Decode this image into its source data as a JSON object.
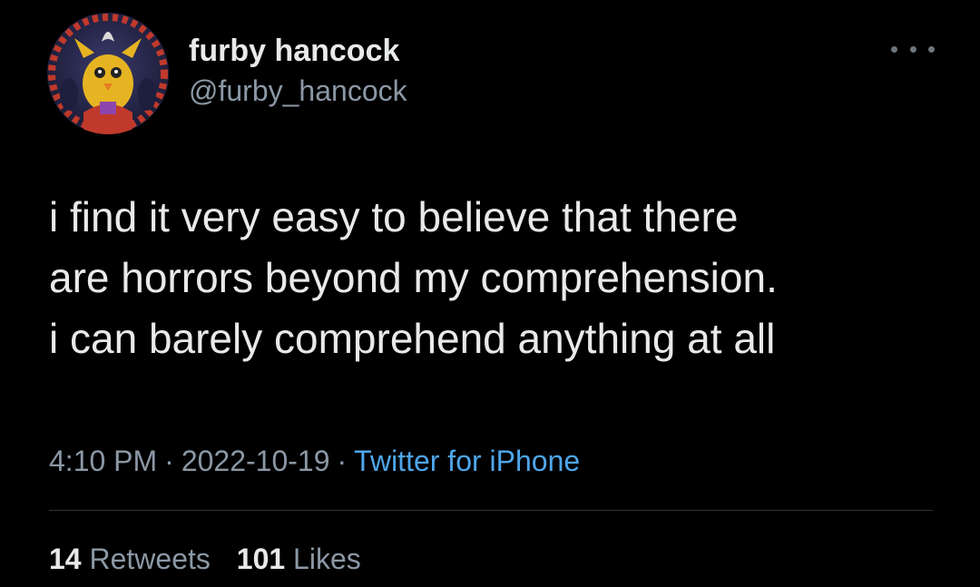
{
  "author": {
    "display_name": "furby hancock",
    "handle": "@furby_hancock",
    "avatar_icon": "furby-avatar-icon"
  },
  "tweet": {
    "lines": [
      "i find it very easy to believe that there",
      "are horrors beyond my comprehension.",
      "i can barely comprehend anything at all"
    ]
  },
  "meta": {
    "time": "4:10 PM",
    "separator": "·",
    "date": "2022-10-19",
    "source": "Twitter for iPhone"
  },
  "stats": {
    "retweets_count": "14",
    "retweets_label": "Retweets",
    "likes_count": "101",
    "likes_label": "Likes"
  },
  "colors": {
    "background": "#000000",
    "primary_text": "#e7e9ea",
    "secondary_text": "#8b98a5",
    "link": "#4fa6ea",
    "divider": "#2f3336"
  }
}
